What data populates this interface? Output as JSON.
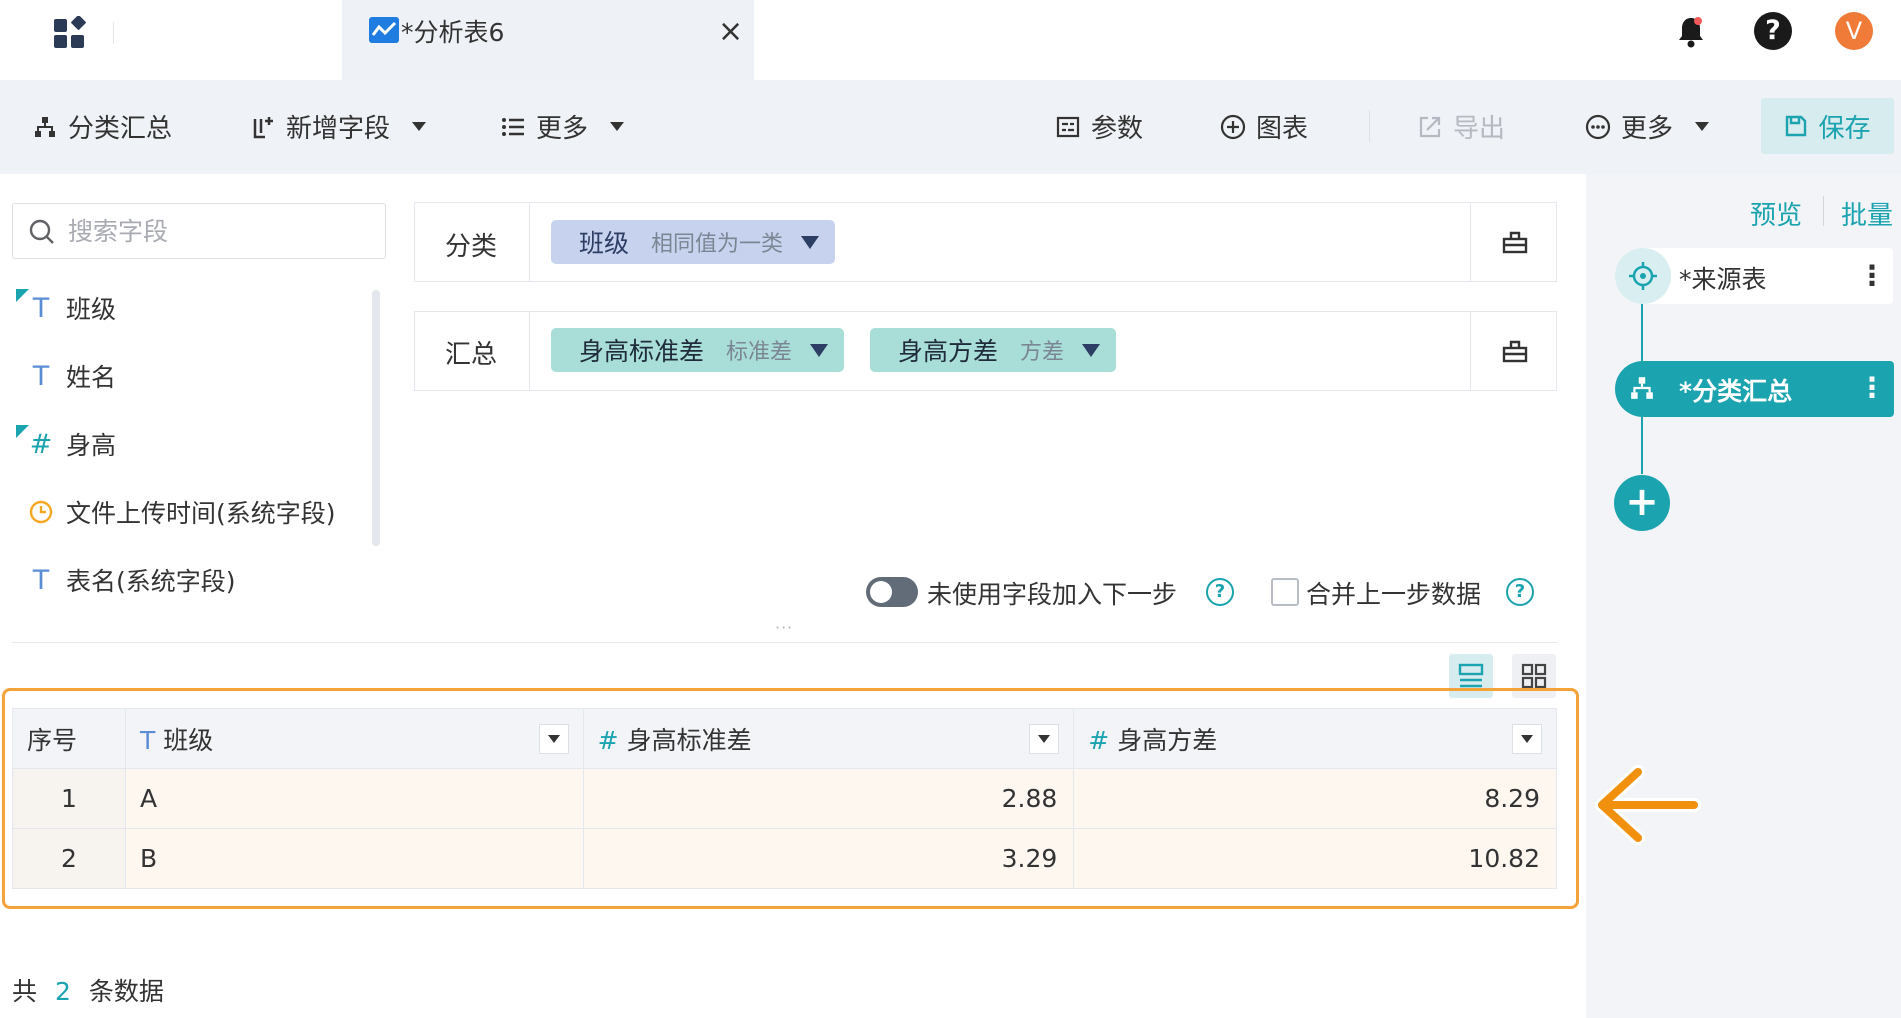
{
  "window": {
    "tab_title": "*分析表6",
    "avatar_letter": "V",
    "help_glyph": "?"
  },
  "toolbar": {
    "summary_label": "分类汇总",
    "add_field_label": "新增字段",
    "more_left_label": "更多",
    "params_label": "参数",
    "chart_label": "图表",
    "export_label": "导出",
    "more_right_label": "更多",
    "save_label": "保存"
  },
  "search": {
    "placeholder": "搜索字段"
  },
  "fields": [
    {
      "label": "班级",
      "type": "text",
      "used": true
    },
    {
      "label": "姓名",
      "type": "text",
      "used": false
    },
    {
      "label": "身高",
      "type": "number",
      "used": true
    },
    {
      "label": "文件上传时间(系统字段)",
      "type": "time",
      "used": false
    },
    {
      "label": "表名(系统字段)",
      "type": "text",
      "used": false
    }
  ],
  "config": {
    "group_label": "分类",
    "group_pill": {
      "name": "班级",
      "mode": "相同值为一类"
    },
    "aggregate_label": "汇总",
    "aggregate_pills": [
      {
        "name": "身高标准差",
        "mode": "标准差"
      },
      {
        "name": "身高方差",
        "mode": "方差"
      }
    ]
  },
  "options": {
    "unused_fields_label": "未使用字段加入下一步",
    "merge_label": "合并上一步数据",
    "help_glyph": "?",
    "drag_handle": "···"
  },
  "table": {
    "columns": [
      {
        "label": "序号"
      },
      {
        "label": "班级",
        "type_glyph": "T"
      },
      {
        "label": "身高标准差",
        "type_glyph": "#"
      },
      {
        "label": "身高方差",
        "type_glyph": "#"
      }
    ],
    "rows": [
      {
        "seq": "1",
        "class": "A",
        "std": "2.88",
        "var": "8.29"
      },
      {
        "seq": "2",
        "class": "B",
        "std": "3.29",
        "var": "10.82"
      }
    ]
  },
  "footer": {
    "prefix": "共",
    "count": "2",
    "suffix": "条数据"
  },
  "right_panel": {
    "preview_label": "预览",
    "batch_label": "批量",
    "nodes": [
      {
        "label": "*来源表"
      },
      {
        "label": "*分类汇总"
      }
    ],
    "add_glyph": "+",
    "kebab_glyph": "⋮"
  },
  "colors": {
    "accent": "#1ba3b0",
    "highlight_frame": "#f4a23a",
    "arrow": "#f0900d",
    "group_pill": "#c7d3ee",
    "aggregate_pill": "#a8ddd8"
  }
}
